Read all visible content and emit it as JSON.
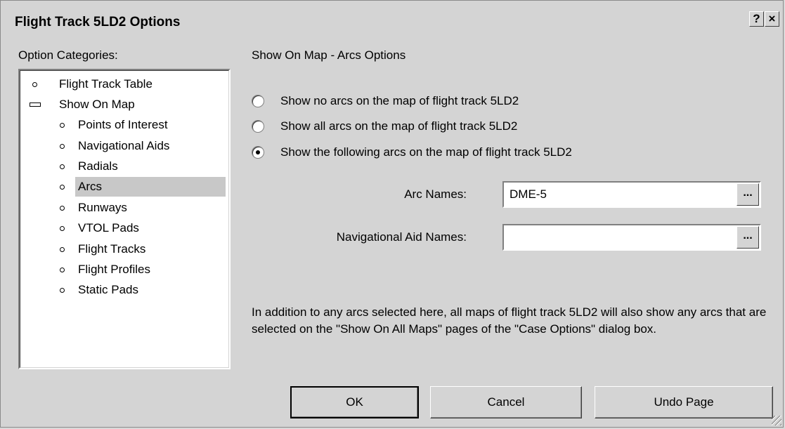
{
  "window": {
    "title": "Flight Track 5LD2 Options",
    "help_label": "?",
    "close_label": "×"
  },
  "categories": {
    "label": "Option Categories:",
    "items": [
      {
        "label": "Flight Track Table",
        "level": 0,
        "marker": "bullet"
      },
      {
        "label": "Show On Map",
        "level": 0,
        "marker": "collapse"
      },
      {
        "label": "Points of Interest",
        "level": 1,
        "marker": "bullet"
      },
      {
        "label": "Navigational Aids",
        "level": 1,
        "marker": "bullet"
      },
      {
        "label": "Radials",
        "level": 1,
        "marker": "bullet"
      },
      {
        "label": "Arcs",
        "level": 1,
        "marker": "bullet",
        "selected": true
      },
      {
        "label": "Runways",
        "level": 1,
        "marker": "bullet"
      },
      {
        "label": "VTOL Pads",
        "level": 1,
        "marker": "bullet"
      },
      {
        "label": "Flight Tracks",
        "level": 1,
        "marker": "bullet"
      },
      {
        "label": "Flight Profiles",
        "level": 1,
        "marker": "bullet"
      },
      {
        "label": "Static Pads",
        "level": 1,
        "marker": "bullet"
      }
    ]
  },
  "page": {
    "heading": "Show On Map - Arcs Options",
    "options": [
      {
        "label": "Show no arcs on the map of flight track 5LD2",
        "checked": false
      },
      {
        "label": "Show all arcs on the map of flight track 5LD2",
        "checked": false
      },
      {
        "label": "Show the following arcs on the map of flight track 5LD2",
        "checked": true
      }
    ],
    "arc_names": {
      "label": "Arc Names:",
      "value": "DME-5"
    },
    "navaid_names": {
      "label": "Navigational Aid Names:",
      "value": ""
    },
    "browse_label": "...",
    "note": "In addition to any arcs selected here, all maps of flight track 5LD2 will also show any arcs that are selected on the \"Show On All Maps\" pages of the \"Case Options\" dialog box."
  },
  "buttons": {
    "ok": "OK",
    "cancel": "Cancel",
    "undo": "Undo Page"
  }
}
